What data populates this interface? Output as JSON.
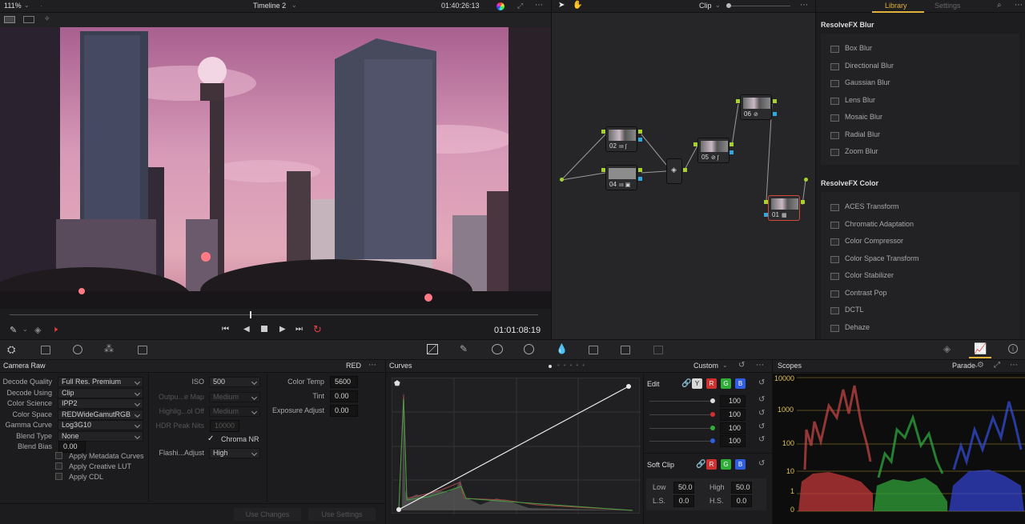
{
  "viewer": {
    "zoom": "111%",
    "timeline_name": "Timeline 2",
    "timecode_top": "01:40:26:13",
    "timecode_bottom": "01:01:08:19"
  },
  "node_editor": {
    "mode_label": "Clip",
    "nodes": [
      {
        "id": "02",
        "label": "02"
      },
      {
        "id": "04",
        "label": "04"
      },
      {
        "id": "05",
        "label": "05"
      },
      {
        "id": "06",
        "label": "06"
      },
      {
        "id": "01",
        "label": "01"
      }
    ]
  },
  "library": {
    "tabs": [
      "Library",
      "Settings"
    ],
    "blur_header": "ResolveFX Blur",
    "blur_items": [
      "Box Blur",
      "Directional Blur",
      "Gaussian Blur",
      "Lens Blur",
      "Mosaic Blur",
      "Radial Blur",
      "Zoom Blur"
    ],
    "color_header": "ResolveFX Color",
    "color_items": [
      "ACES Transform",
      "Chromatic Adaptation",
      "Color Compressor",
      "Color Space Transform",
      "Color Stabilizer",
      "Contrast Pop",
      "DCTL",
      "Dehaze"
    ]
  },
  "camera_raw": {
    "title": "Camera Raw",
    "badge": "RED",
    "decode_quality_label": "Decode Quality",
    "decode_quality": "Full Res. Premium",
    "decode_using_label": "Decode Using",
    "decode_using": "Clip",
    "color_science_label": "Color Science",
    "color_science": "IPP2",
    "color_space_label": "Color Space",
    "color_space": "REDWideGamutRGB",
    "gamma_curve_label": "Gamma Curve",
    "gamma_curve": "Log3G10",
    "blend_type_label": "Blend Type",
    "blend_type": "None",
    "blend_bias_label": "Blend Bias",
    "blend_bias": "0.00",
    "apply_metadata_curves": "Apply Metadata Curves",
    "apply_creative_lut": "Apply Creative LUT",
    "apply_cdl": "Apply CDL",
    "iso_label": "ISO",
    "iso": "500",
    "output_map_label": "Outpu...e Map",
    "output_map": "Medium",
    "highlight_rolloff_label": "Highlig...ol Off",
    "highlight_rolloff": "Medium",
    "hdr_peak_label": "HDR Peak Nits",
    "hdr_peak": "10000",
    "chroma_nr": "Chroma NR",
    "flashing_label": "Flashi...Adjust",
    "flashing": "High",
    "color_temp_label": "Color Temp",
    "color_temp": "5600",
    "tint_label": "Tint",
    "tint": "0.00",
    "exposure_label": "Exposure Adjust",
    "exposure": "0.00",
    "use_changes": "Use Changes",
    "use_settings": "Use Settings"
  },
  "curves": {
    "title": "Curves",
    "preset": "Custom",
    "edit_label": "Edit",
    "channels": [
      "Y",
      "R",
      "G",
      "B"
    ],
    "intensity": [
      "100",
      "100",
      "100",
      "100"
    ],
    "soft_clip_label": "Soft Clip",
    "low_label": "Low",
    "low": "50.0",
    "high_label": "High",
    "high": "50.0",
    "ls_label": "L.S.",
    "ls": "0.0",
    "hs_label": "H.S.",
    "hs": "0.0"
  },
  "scopes": {
    "title": "Scopes",
    "type": "Parade",
    "scale": [
      "10000",
      "1000",
      "100",
      "10",
      "1",
      "0"
    ]
  },
  "colors": {
    "accent": "#e0b23a",
    "red": "#d0302e",
    "green": "#2fae3a",
    "blue": "#2f5fe0"
  }
}
